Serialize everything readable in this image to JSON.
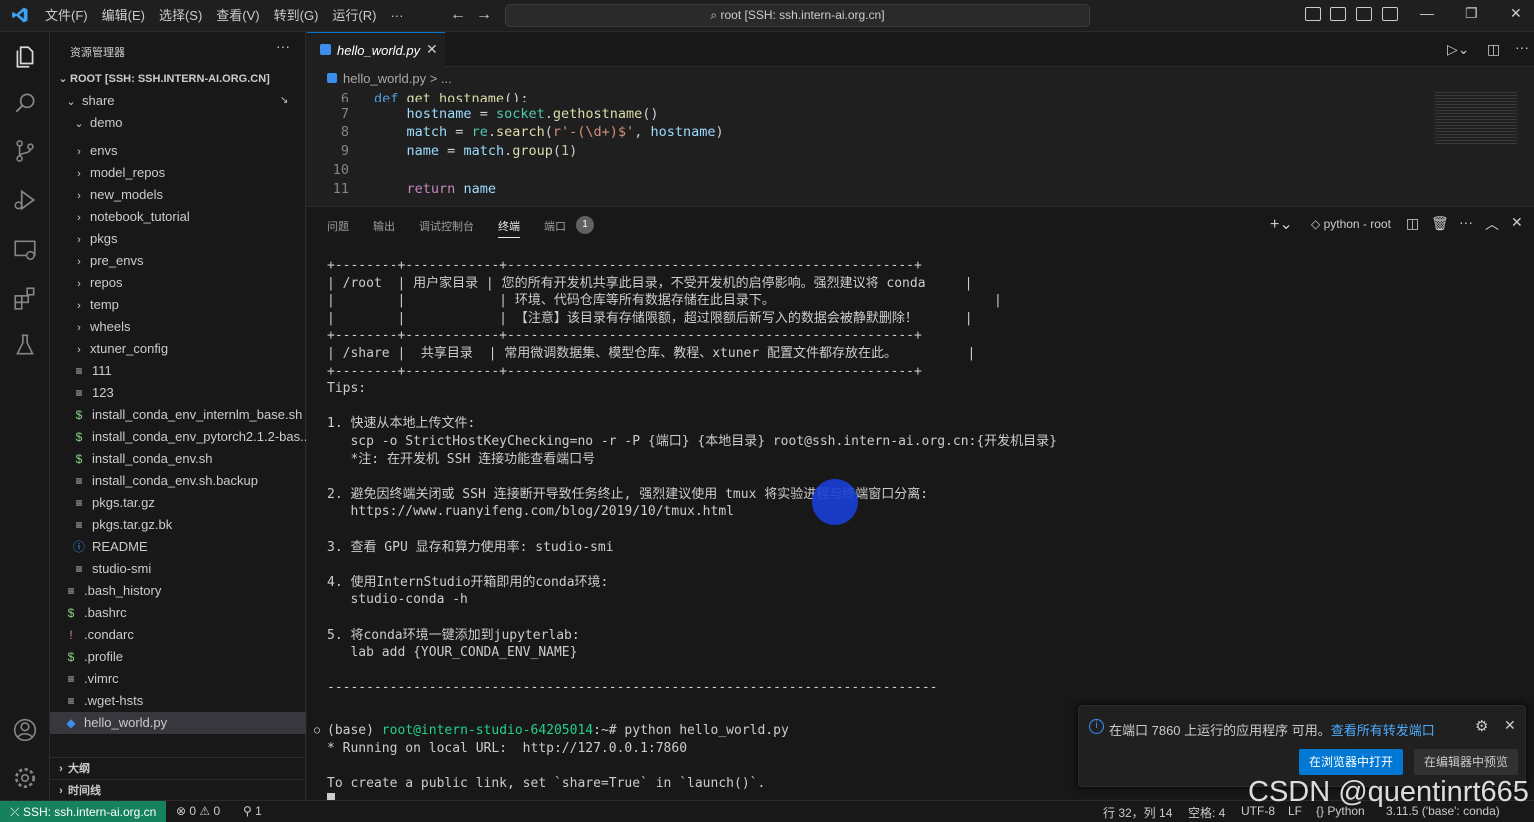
{
  "titlebar": {
    "menu": [
      "文件(F)",
      "编辑(E)",
      "选择(S)",
      "查看(V)",
      "转到(G)",
      "运行(R)",
      "···"
    ],
    "search": "root [SSH: ssh.intern-ai.org.cn]"
  },
  "sidebar": {
    "title": "资源管理器",
    "more": "···",
    "root_label": "ROOT [SSH: SSH.INTERN-AI.ORG.CN]",
    "items": [
      {
        "label": "share",
        "icon": "chevron-down"
      },
      {
        "label": "demo",
        "icon": "chevron-down"
      },
      {
        "label": "envs",
        "icon": "chevron-right"
      },
      {
        "label": "model_repos",
        "icon": "chevron-right"
      },
      {
        "label": "new_models",
        "icon": "chevron-right"
      },
      {
        "label": "notebook_tutorial",
        "icon": "chevron-right"
      },
      {
        "label": "pkgs",
        "icon": "chevron-right"
      },
      {
        "label": "pre_envs",
        "icon": "chevron-right"
      },
      {
        "label": "repos",
        "icon": "chevron-right"
      },
      {
        "label": "temp",
        "icon": "chevron-right"
      },
      {
        "label": "wheels",
        "icon": "chevron-right"
      },
      {
        "label": "xtuner_config",
        "icon": "chevron-right"
      },
      {
        "label": "111",
        "icon": "lines"
      },
      {
        "label": "123",
        "icon": "lines"
      },
      {
        "label": "install_conda_env_internlm_base.sh",
        "icon": "dollar"
      },
      {
        "label": "install_conda_env_pytorch2.1.2-bas...",
        "icon": "dollar"
      },
      {
        "label": "install_conda_env.sh",
        "icon": "dollar"
      },
      {
        "label": "install_conda_env.sh.backup",
        "icon": "lines"
      },
      {
        "label": "pkgs.tar.gz",
        "icon": "lines"
      },
      {
        "label": "pkgs.tar.gz.bk",
        "icon": "lines"
      },
      {
        "label": "README",
        "icon": "info"
      },
      {
        "label": "studio-smi",
        "icon": "lines"
      },
      {
        "label": ".bash_history",
        "icon": "lines"
      },
      {
        "label": ".bashrc",
        "icon": "dollar"
      },
      {
        "label": ".condarc",
        "icon": "exclaim"
      },
      {
        "label": ".profile",
        "icon": "dollar"
      },
      {
        "label": ".vimrc",
        "icon": "lines"
      },
      {
        "label": ".wget-hsts",
        "icon": "lines"
      },
      {
        "label": "hello_world.py",
        "icon": "python"
      }
    ],
    "outline": "大纲",
    "timeline": "时间线"
  },
  "editor": {
    "tab": "hello_world.py",
    "breadcrumb": "hello_world.py > ...",
    "lines": [
      {
        "n": "6",
        "code": "def get_hostname():"
      },
      {
        "n": "7",
        "code": "    hostname = socket.gethostname()"
      },
      {
        "n": "8",
        "code": "    match = re.search(r'-(\\d+)$', hostname)"
      },
      {
        "n": "9",
        "code": "    name = match.group(1)"
      },
      {
        "n": "10",
        "code": ""
      },
      {
        "n": "11",
        "code": "    return name"
      }
    ]
  },
  "panel": {
    "tabs": [
      "问题",
      "输出",
      "调试控制台",
      "终端",
      "端口"
    ],
    "ports_badge": "1",
    "terminal_name": "python - root",
    "terminal_lines": [
      "+--------+------------+----------------------------------------------------+",
      "| /root  | 用户家目录 | 您的所有开发机共享此目录，不受开发机的启停影响。强烈建议将 conda     |",
      "|        |            | 环境、代码仓库等所有数据存储在此目录下。                            |",
      "|        |            | 【注意】该目录有存储限额，超过限额后新写入的数据会被静默删除！      |",
      "+--------+------------+----------------------------------------------------+",
      "| /share |  共享目录  | 常用微调数据集、模型仓库、教程、xtuner 配置文件都存放在此。         |",
      "+--------+------------+----------------------------------------------------+",
      "Tips:",
      "",
      "1. 快速从本地上传文件:",
      "   scp -o StrictHostKeyChecking=no -r -P {端口} {本地目录} root@ssh.intern-ai.org.cn:{开发机目录}",
      "   *注: 在开发机 SSH 连接功能查看端口号",
      "",
      "2. 避免因终端关闭或 SSH 连接断开导致任务终止, 强烈建议使用 tmux 将实验进程与终端窗口分离:",
      "   https://www.ruanyifeng.com/blog/2019/10/tmux.html",
      "",
      "3. 查看 GPU 显存和算力使用率: studio-smi",
      "",
      "4. 使用InternStudio开箱即用的conda环境:",
      "   studio-conda -h",
      "",
      "5. 将conda环境一键添加到jupyterlab:",
      "   lab add {YOUR_CONDA_ENV_NAME}",
      "",
      "------------------------------------------------------------------------------",
      ""
    ],
    "prompt_env": "(base) ",
    "prompt_user": "root@intern-studio-64205014",
    "prompt_rest": ":~# python hello_world.py",
    "output": [
      "* Running on local URL:  http://127.0.0.1:7860",
      "",
      "To create a public link, set `share=True` in `launch()`."
    ]
  },
  "notification": {
    "message": "在端口 7860 上运行的应用程序 可用。",
    "link": "查看所有转发端口",
    "primary": "在浏览器中打开",
    "secondary": "在编辑器中预览"
  },
  "status": {
    "remote": "SSH: ssh.intern-ai.org.cn",
    "problems": "⊗ 0 ⚠ 0",
    "ports": "1",
    "position": "行 32，列 14",
    "spaces": "空格: 4",
    "encoding": "UTF-8",
    "eol": "LF",
    "language": "Python",
    "interpreter": "3.11.5 ('base': conda)"
  },
  "watermark": "CSDN @quentinrt665",
  "colors": {
    "accent": "#0078d4",
    "remote": "#16825d",
    "link": "#4daafc",
    "prompt_green": "#23d18b"
  }
}
